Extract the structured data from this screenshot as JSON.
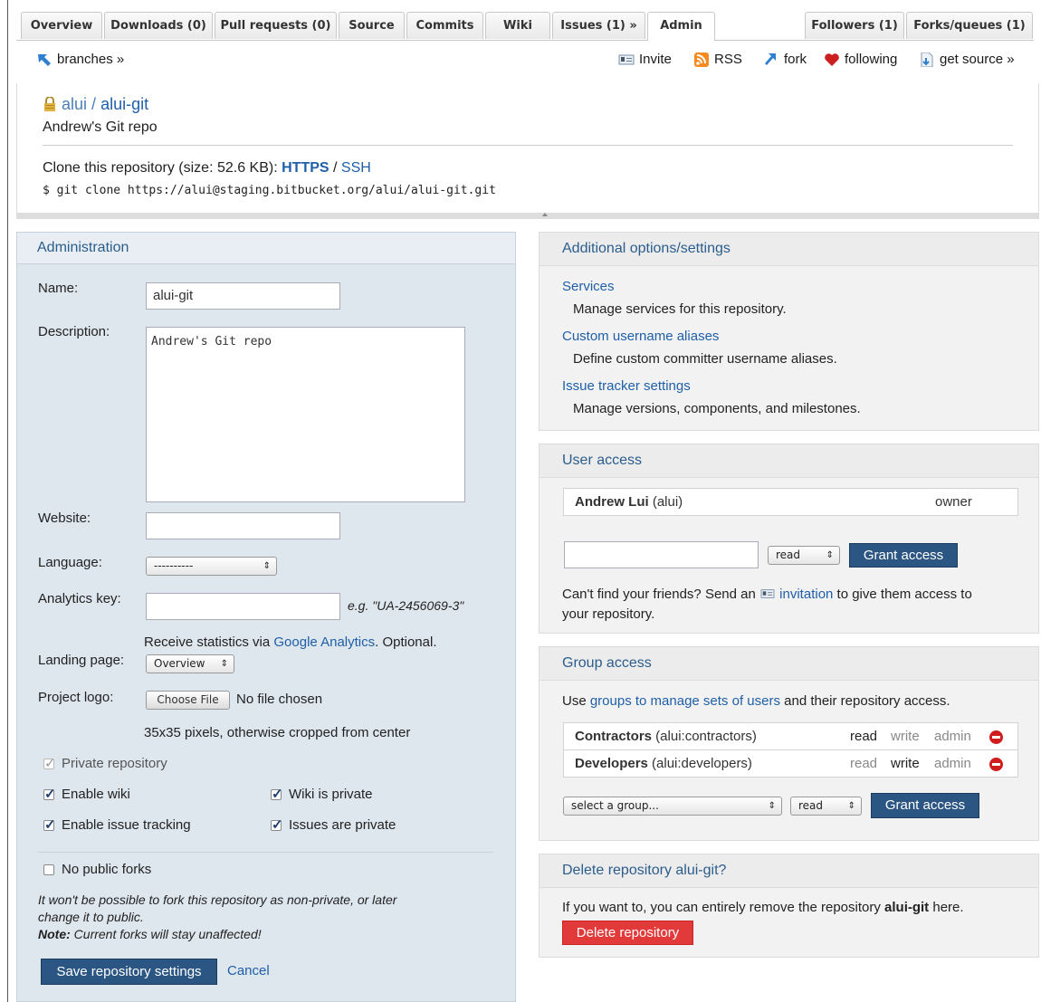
{
  "tabs_left": [
    {
      "label": "Overview"
    },
    {
      "label": "Downloads (0)"
    },
    {
      "label": "Pull requests (0)"
    },
    {
      "label": "Source"
    },
    {
      "label": "Commits"
    },
    {
      "label": "Wiki"
    },
    {
      "label": "Issues (1) »"
    },
    {
      "label": "Admin"
    }
  ],
  "tabs_right": [
    {
      "label": "Followers (1)"
    },
    {
      "label": "Forks/queues (1)"
    }
  ],
  "toolbar": {
    "branches": "branches »",
    "invite": "Invite",
    "rss": "RSS",
    "fork": "fork",
    "following": "following",
    "get_source": "get source »"
  },
  "repo": {
    "owner": "alui",
    "separator": " / ",
    "name": "alui-git",
    "description": "Andrew's Git repo",
    "clone_prefix": "Clone this repository (size: 52.6 KB): ",
    "https": "HTTPS",
    "slash": " / ",
    "ssh": "SSH",
    "clone_cmd": "$ git clone https://alui@staging.bitbucket.org/alui/alui-git.git"
  },
  "admin": {
    "title": "Administration",
    "name_label": "Name:",
    "name_value": "alui-git",
    "description_label": "Description:",
    "description_value": "Andrew's Git repo",
    "website_label": "Website:",
    "website_value": "",
    "language_label": "Language:",
    "language_value": "----------",
    "analytics_label": "Analytics key:",
    "analytics_value": "",
    "analytics_example": "e.g. \"UA-2456069-3\"",
    "analytics_help_prefix": "Receive statistics via ",
    "analytics_help_link": "Google Analytics",
    "analytics_help_suffix": ". Optional.",
    "landing_label": "Landing page:",
    "landing_value": "Overview",
    "logo_label": "Project logo:",
    "choose_file": "Choose File",
    "no_file": "No file chosen",
    "logo_help": "35x35 pixels, otherwise cropped from center",
    "private_repo": "Private repository",
    "enable_wiki": "Enable wiki",
    "wiki_private": "Wiki is private",
    "enable_issue_tracking": "Enable issue tracking",
    "issues_private": "Issues are private",
    "no_public_forks": "No public forks",
    "fork_note_1": "It won't be possible to fork this repository as non-private, or later",
    "fork_note_2": "change it to public.",
    "note_bold": "Note:",
    "note_text": " Current forks will stay unaffected!",
    "save_button": "Save repository settings",
    "cancel": "Cancel"
  },
  "options": {
    "title": "Additional options/settings",
    "items": [
      {
        "link": "Services",
        "desc": "Manage services for this repository."
      },
      {
        "link": "Custom username aliases",
        "desc": "Define custom committer username aliases."
      },
      {
        "link": "Issue tracker settings",
        "desc": "Manage versions, components, and milestones."
      }
    ]
  },
  "user_access": {
    "title": "User access",
    "user_name": "Andrew Lui",
    "user_handle": " (alui)",
    "user_role": "owner",
    "perm_value": "read",
    "grant_button": "Grant access",
    "help_prefix": "Can't find your friends? Send an ",
    "help_link": "invitation",
    "help_suffix": " to give them access to",
    "help_line2": "your repository."
  },
  "group_access": {
    "title": "Group access",
    "intro_prefix": "Use ",
    "intro_link": "groups to manage sets of users",
    "intro_suffix": " and their repository access.",
    "groups": [
      {
        "name": "Contractors",
        "id": " (alui:contractors)",
        "read": "read",
        "write": "write",
        "admin": "admin",
        "active": "read"
      },
      {
        "name": "Developers",
        "id": " (alui:developers)",
        "read": "read",
        "write": "write",
        "admin": "admin",
        "active": "write"
      }
    ],
    "select_group": "select a group...",
    "perm_value": "read",
    "grant_button": "Grant access"
  },
  "delete": {
    "title": "Delete repository alui-git?",
    "text_prefix": "If you want to, you can entirely remove the repository ",
    "text_bold": "alui-git",
    "text_suffix": " here.",
    "button": "Delete repository"
  }
}
